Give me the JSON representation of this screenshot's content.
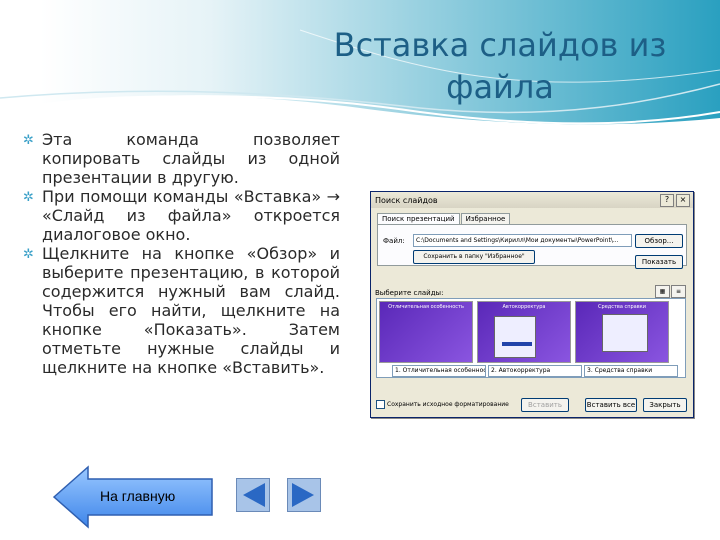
{
  "slide": {
    "title_line1": "Вставка слайдов из",
    "title_line2": "файла",
    "bullets": [
      "Эта команда позволяет копировать слайды из одной презентации в другую.",
      "При помощи команды «Вставка» → «Слайд из файла» откроется диалоговое окно.",
      "Щелкните на кнопке «Обзор» и выберите презентацию, в которой содержится нужный вам слайд. Чтобы его найти, щелкните на кнопке «Показать». Затем отметьте нужные слайды и щелкните на кнопке «Вставить»."
    ],
    "bullet_icon": "star-bullet-icon",
    "accent_color": "#1d5f86"
  },
  "dialog": {
    "title": "Поиск слайдов",
    "help_glyph": "?",
    "close_glyph": "×",
    "tabs": [
      "Поиск презентаций",
      "Избранное"
    ],
    "file_label": "Файл:",
    "file_value": "C:\\Documents and Settings\\Кирилл\\Мои документы\\PowerPoint\\...",
    "browse_label": "Обзор...",
    "favorite_label": "Сохранить в папку \"Избранное\"",
    "show_label": "Показать",
    "slides_label": "Выберите слайды:",
    "thumbnails": [
      {
        "caption": "1. Отличительная особенность",
        "header": "Отличительная особенность"
      },
      {
        "caption": "2. Автокорректура",
        "header": "Автокорректура"
      },
      {
        "caption": "3. Средства справки",
        "header": "Средства справки"
      }
    ],
    "keep_format_label": "Сохранить исходное форматирование",
    "insert_label": "Вставить",
    "insert_all_label": "Вставить все",
    "close_label": "Закрыть"
  },
  "nav": {
    "home_label": "На главную",
    "home_icon": "left-arrow-icon",
    "prev_icon": "prev-triangle-icon",
    "next_icon": "next-triangle-icon"
  }
}
